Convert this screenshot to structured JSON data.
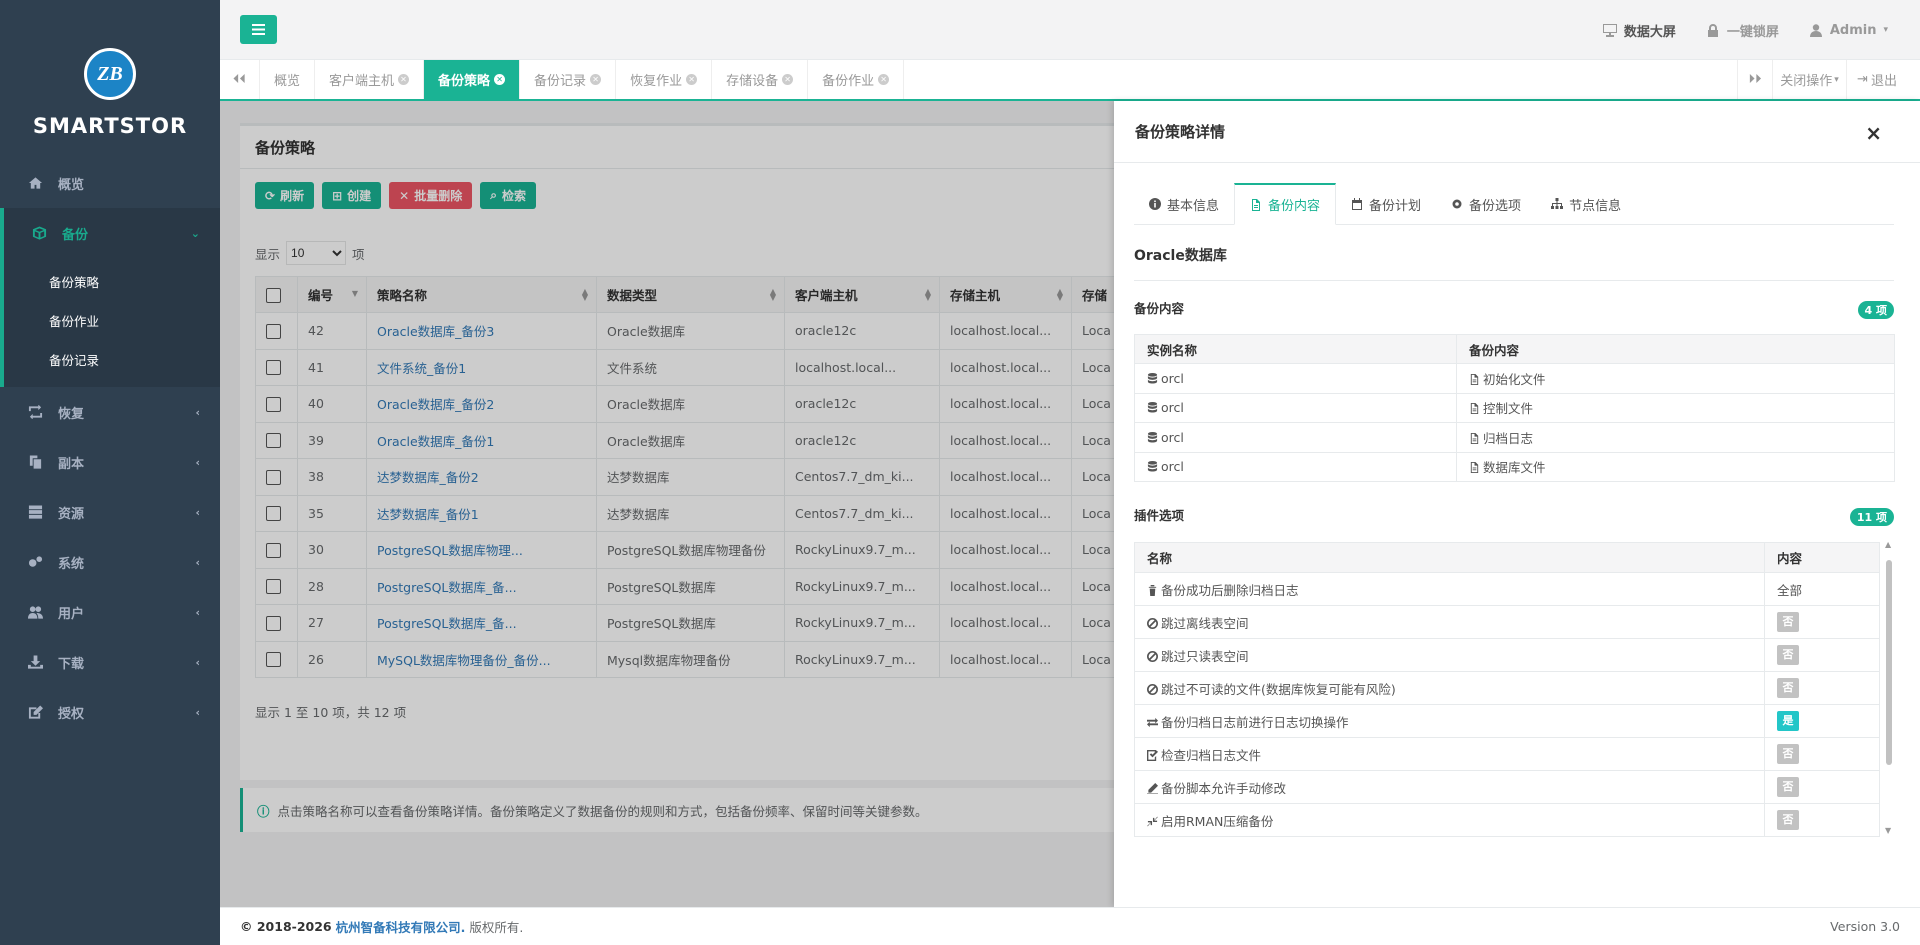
{
  "brand": {
    "logo_text": "SMARTSTOR",
    "logo_mark": "ZB"
  },
  "sidebar": {
    "items": [
      {
        "label": "概览",
        "icon": "home-icon"
      },
      {
        "label": "备份",
        "icon": "cube-icon",
        "active": true,
        "children": [
          "备份策略",
          "备份作业",
          "备份记录"
        ]
      },
      {
        "label": "恢复",
        "icon": "retweet-icon"
      },
      {
        "label": "副本",
        "icon": "copy-icon"
      },
      {
        "label": "资源",
        "icon": "server-icon"
      },
      {
        "label": "系统",
        "icon": "cogs-icon"
      },
      {
        "label": "用户",
        "icon": "users-icon"
      },
      {
        "label": "下载",
        "icon": "download-icon"
      },
      {
        "label": "授权",
        "icon": "edit-icon"
      }
    ]
  },
  "topbar": {
    "screen": "数据大屏",
    "lock": "一键锁屏",
    "user": "Admin"
  },
  "tabs": {
    "items": [
      "概览",
      "客户端主机",
      "备份策略",
      "备份记录",
      "恢复作业",
      "存储设备",
      "备份作业"
    ],
    "active_index": 2,
    "close_ops": "关闭操作",
    "logout": "退出"
  },
  "panel": {
    "title": "备份策略",
    "buttons": {
      "refresh": "刷新",
      "create": "创建",
      "batch_delete": "批量删除",
      "search": "检索"
    },
    "length": {
      "prefix": "显示",
      "value": "10",
      "suffix": "项"
    },
    "columns": [
      "编号",
      "策略名称",
      "数据类型",
      "客户端主机",
      "存储主机",
      "存储"
    ],
    "rows": [
      [
        "42",
        "Oracle数据库_备份3",
        "Oracle数据库",
        "oracle12c",
        "localhost.local...",
        "Loca"
      ],
      [
        "41",
        "文件系统_备份1",
        "文件系统",
        "localhost.local...",
        "localhost.local...",
        "Loca"
      ],
      [
        "40",
        "Oracle数据库_备份2",
        "Oracle数据库",
        "oracle12c",
        "localhost.local...",
        "Loca"
      ],
      [
        "39",
        "Oracle数据库_备份1",
        "Oracle数据库",
        "oracle12c",
        "localhost.local...",
        "Loca"
      ],
      [
        "38",
        "达梦数据库_备份2",
        "达梦数据库",
        "Centos7.7_dm_ki...",
        "localhost.local...",
        "Loca"
      ],
      [
        "35",
        "达梦数据库_备份1",
        "达梦数据库",
        "Centos7.7_dm_ki...",
        "localhost.local...",
        "Loca"
      ],
      [
        "30",
        "PostgreSQL数据库物理...",
        "PostgreSQL数据库物理备份",
        "RockyLinux9.7_m...",
        "localhost.local...",
        "Loca"
      ],
      [
        "28",
        "PostgreSQL数据库_备...",
        "PostgreSQL数据库",
        "RockyLinux9.7_m...",
        "localhost.local...",
        "Loca"
      ],
      [
        "27",
        "PostgreSQL数据库_备...",
        "PostgreSQL数据库",
        "RockyLinux9.7_m...",
        "localhost.local...",
        "Loca"
      ],
      [
        "26",
        "MySQL数据库物理备份_备份...",
        "Mysql数据库物理备份",
        "RockyLinux9.7_m...",
        "localhost.local...",
        "Loca"
      ]
    ],
    "info": "显示 1 至 10 项，共 12 项"
  },
  "alert": "点击策略名称可以查看备份策略详情。备份策略定义了数据备份的规则和方式，包括备份频率、保留时间等关键参数。",
  "drawer": {
    "title": "备份策略详情",
    "close": "×",
    "tabs": [
      {
        "label": "基本信息",
        "icon": "info-circle-icon"
      },
      {
        "label": "备份内容",
        "icon": "file-text-icon",
        "active": true
      },
      {
        "label": "备份计划",
        "icon": "calendar-icon"
      },
      {
        "label": "备份选项",
        "icon": "gear-icon"
      },
      {
        "label": "节点信息",
        "icon": "sitemap-icon"
      }
    ],
    "subtitle": "Oracle数据库",
    "content": {
      "title": "备份内容",
      "badge": "4 项",
      "columns": [
        "实例名称",
        "备份内容"
      ],
      "rows": [
        [
          "orcl",
          "初始化文件"
        ],
        [
          "orcl",
          "控制文件"
        ],
        [
          "orcl",
          "归档日志"
        ],
        [
          "orcl",
          "数据库文件"
        ]
      ]
    },
    "options": {
      "title": "插件选项",
      "badge": "11 项",
      "columns": [
        "名称",
        "内容"
      ],
      "rows": [
        {
          "icon": "trash-icon",
          "name": "备份成功后删除归档日志",
          "value": "全部",
          "kind": "text"
        },
        {
          "icon": "ban-icon",
          "name": "跳过离线表空间",
          "value": "否",
          "kind": "no"
        },
        {
          "icon": "ban-icon",
          "name": "跳过只读表空间",
          "value": "否",
          "kind": "no"
        },
        {
          "icon": "ban-icon",
          "name": "跳过不可读的文件(数据库恢复可能有风险)",
          "value": "否",
          "kind": "no"
        },
        {
          "icon": "exchange-icon",
          "name": "备份归档日志前进行日志切换操作",
          "value": "是",
          "kind": "yes"
        },
        {
          "icon": "check-square-icon",
          "name": "检查归档日志文件",
          "value": "否",
          "kind": "no"
        },
        {
          "icon": "pencil-icon",
          "name": "备份脚本允许手动修改",
          "value": "否",
          "kind": "no"
        },
        {
          "icon": "compress-icon",
          "name": "启用RMAN压缩备份",
          "value": "否",
          "kind": "no"
        }
      ]
    }
  },
  "footer": {
    "copyright": "© 2018-2026",
    "company": "杭州智备科技有限公司.",
    "rights": "版权所有.",
    "version": "Version 3.0"
  }
}
